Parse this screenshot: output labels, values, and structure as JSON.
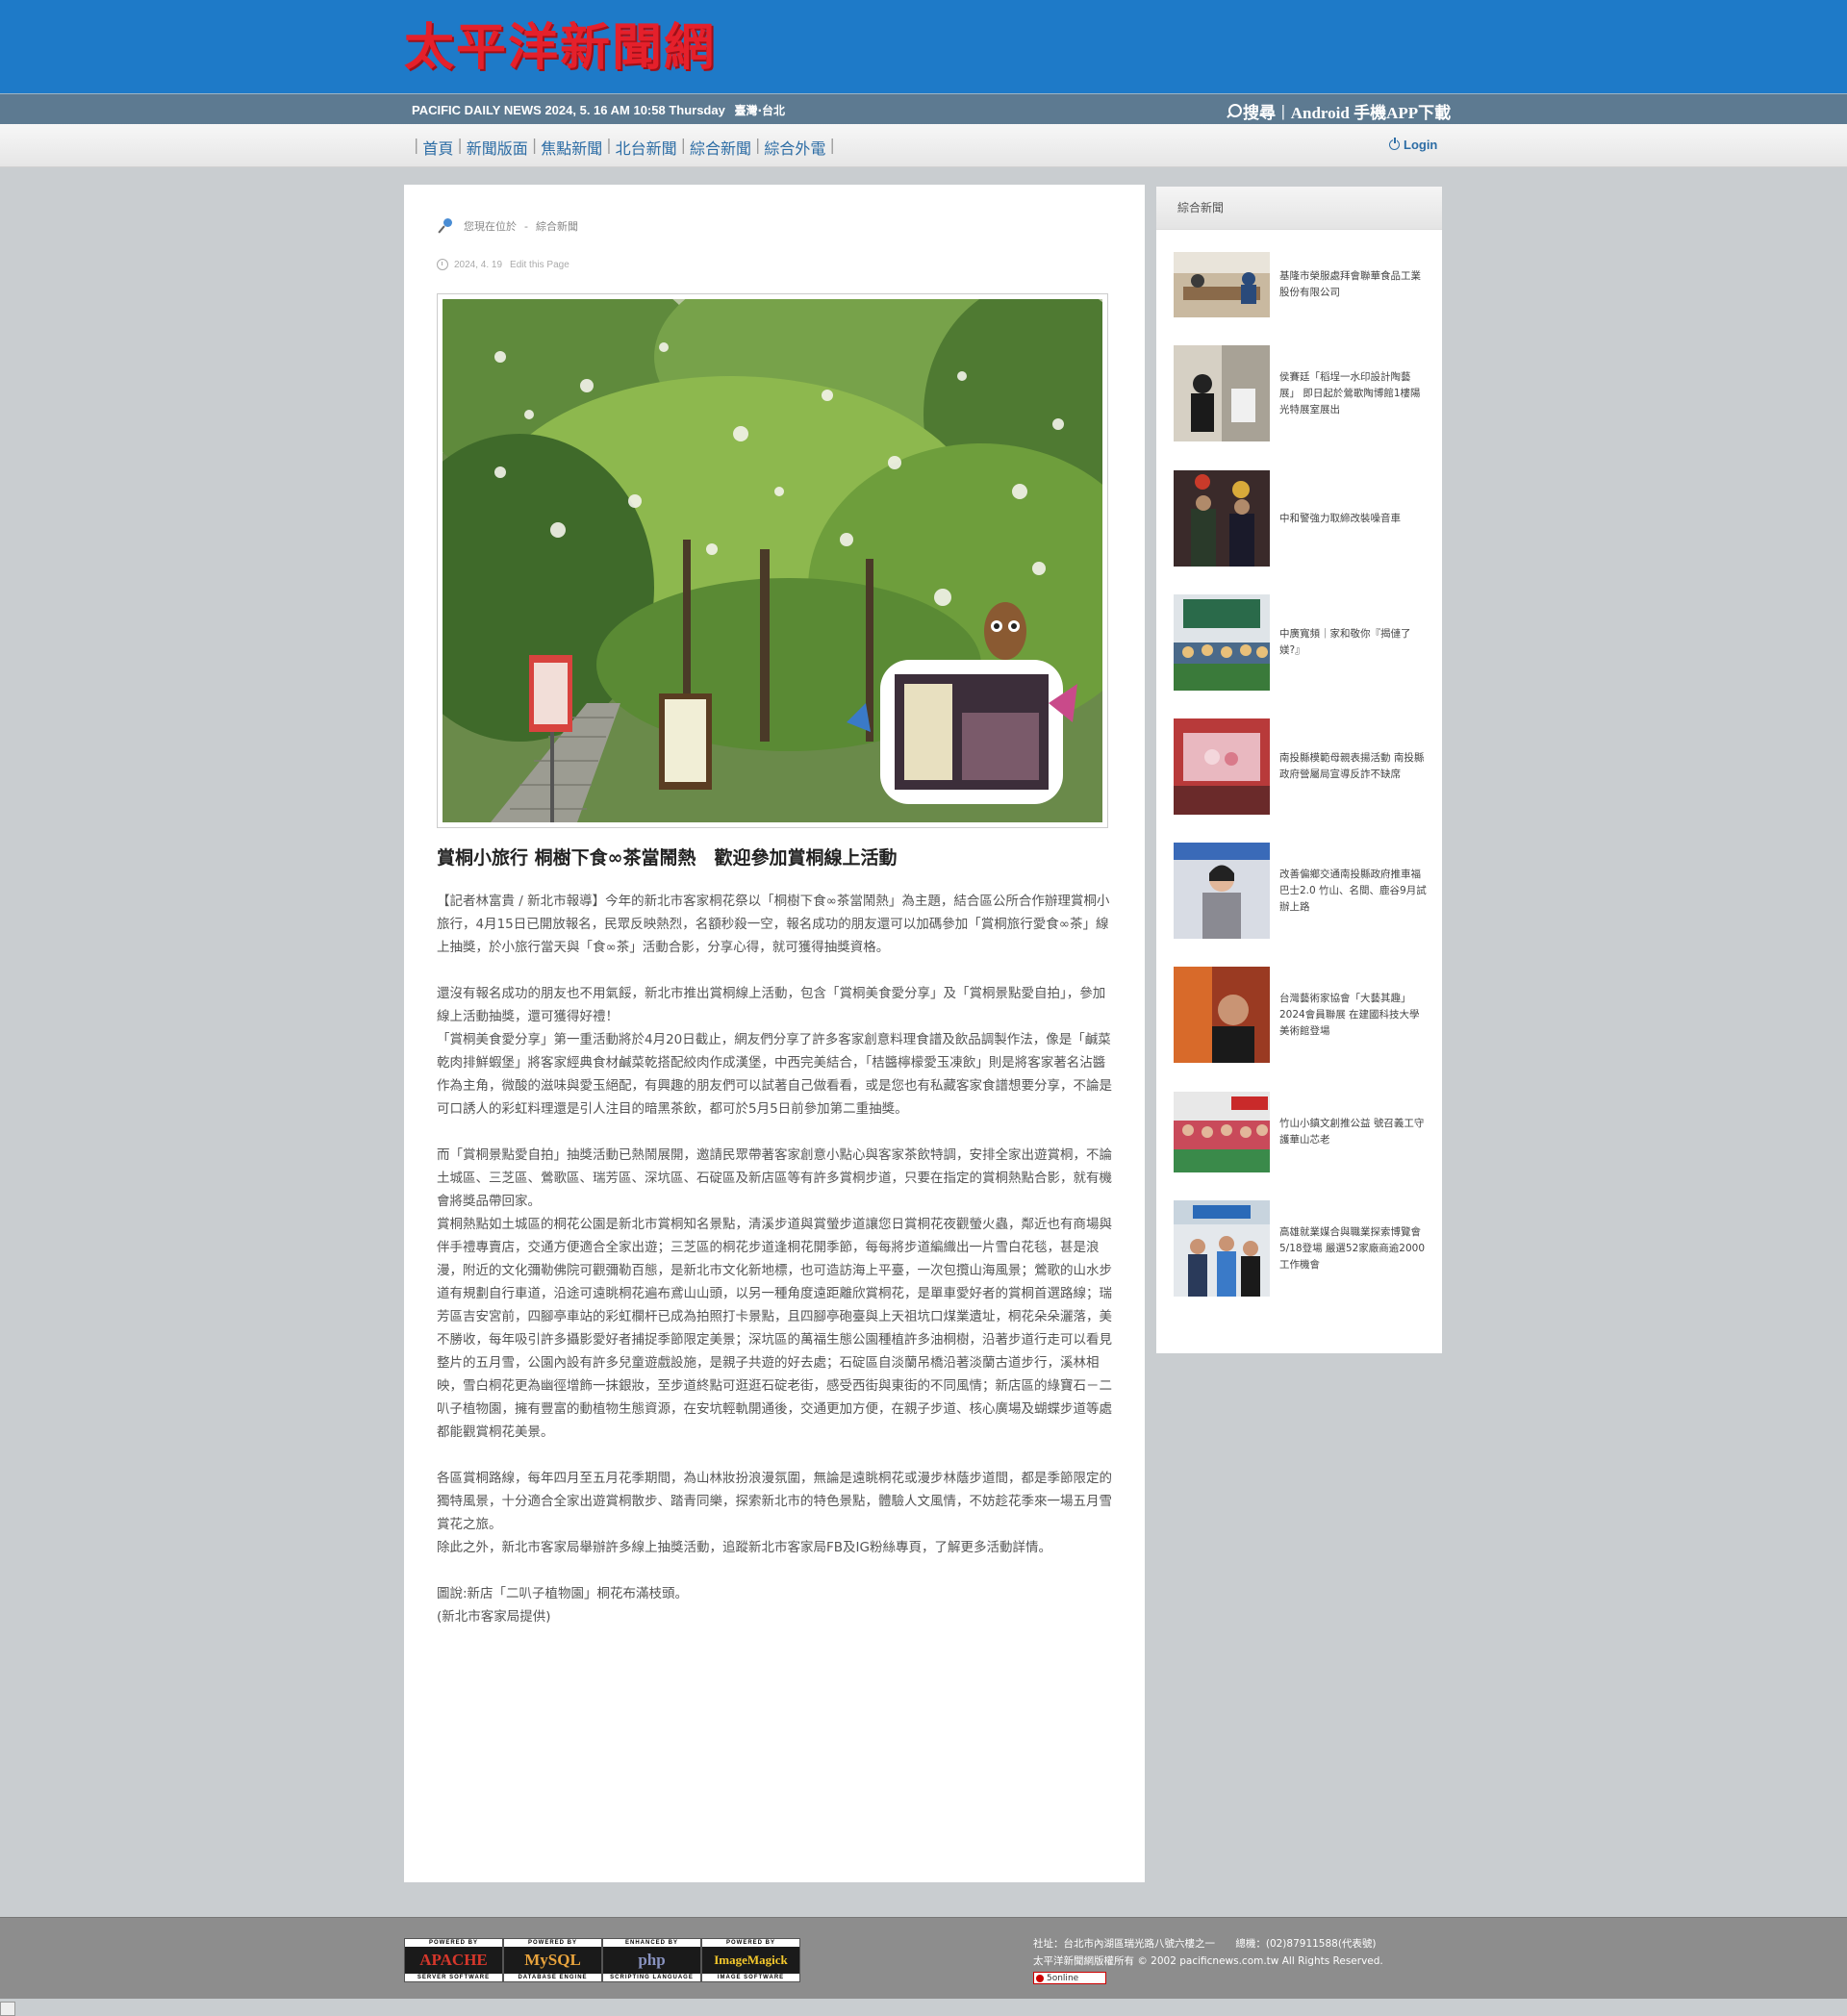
{
  "header": {
    "logo_text": "太平洋新聞網",
    "date_text": "PACIFIC DAILY NEWS 2024, 5. 16 AM 10:58 Thursday",
    "location": "臺灣·台北",
    "search_label": "搜尋",
    "app_label": "Android 手機APP下載"
  },
  "nav": {
    "items": [
      "首頁",
      "新聞版面",
      "焦點新聞",
      "北台新聞",
      "綜合新聞",
      "綜合外電"
    ],
    "login_label": "Login"
  },
  "article": {
    "breadcrumb_prefix": "您現在位於",
    "breadcrumb_section": "綜合新聞",
    "date": "2024, 4. 19",
    "edit_label": "Edit this Page",
    "title": "賞桐小旅行 桐樹下食∞茶當鬧熱　歡迎參加賞桐線上活動",
    "paragraphs": [
      "【記者林富貴 / 新北市報導】今年的新北市客家桐花祭以「桐樹下食∞茶當鬧熱」為主題，結合區公所合作辦理賞桐小旅行，4月15日已開放報名，民眾反映熱烈，名額秒殺一空，報名成功的朋友還可以加碼參加「賞桐旅行愛食∞茶」線上抽獎，於小旅行當天與「食∞茶」活動合影，分享心得，就可獲得抽獎資格。",
      "",
      "還沒有報名成功的朋友也不用氣餒，新北市推出賞桐線上活動，包含「賞桐美食愛分享」及「賞桐景點愛自拍」，參加線上活動抽獎，還可獲得好禮！",
      "「賞桐美食愛分享」第一重活動將於4月20日截止，網友們分享了許多客家創意料理食譜及飲品調製作法，像是「鹹菜乾肉排鮮蝦堡」將客家經典食材鹹菜乾搭配絞肉作成漢堡，中西完美結合，「桔醬檸檬愛玉凍飲」則是將客家著名沾醬作為主角，微酸的滋味與愛玉絕配，有興趣的朋友們可以試著自己做看看，或是您也有私藏客家食譜想要分享，不論是可口誘人的彩虹料理還是引人注目的暗黑茶飲，都可於5月5日前參加第二重抽獎。",
      "",
      "而「賞桐景點愛自拍」抽獎活動已熱鬧展開，邀請民眾帶著客家創意小點心與客家茶飲特調，安排全家出遊賞桐，不論土城區、三芝區、鶯歌區、瑞芳區、深坑區、石碇區及新店區等有許多賞桐步道，只要在指定的賞桐熱點合影，就有機會將獎品帶回家。",
      "賞桐熱點如土城區的桐花公園是新北市賞桐知名景點，清溪步道與賞螢步道讓您日賞桐花夜觀螢火蟲，鄰近也有商場與伴手禮專賣店，交通方便適合全家出遊；三芝區的桐花步道逢桐花開季節，每每將步道編織出一片雪白花毯，甚是浪漫，附近的文化彌勒佛院可觀彌勒百態，是新北市文化新地標，也可造訪海上平臺，一次包攬山海風景；鶯歌的山水步道有規劃自行車道，沿途可遠眺桐花遍布鳶山山頭，以另一種角度遠距離欣賞桐花，是單車愛好者的賞桐首選路線；瑞芳區吉安宮前，四腳亭車站的彩虹欄杆已成為拍照打卡景點，且四腳亭砲臺與上天祖坑口煤業遺址，桐花朵朵灑落，美不勝收，每年吸引許多攝影愛好者捕捉季節限定美景；深坑區的萬福生態公園種植許多油桐樹，沿著步道行走可以看見整片的五月雪，公園內設有許多兒童遊戲設施，是親子共遊的好去處；石碇區自淡蘭吊橋沿著淡蘭古道步行，溪林相映，雪白桐花更為幽徑增飾一抹銀妝，至步道終點可逛逛石碇老街，感受西街與東街的不同風情；新店區的綠寶石－二叭子植物園，擁有豐富的動植物生態資源，在安坑輕軌開通後，交通更加方便，在親子步道、核心廣場及蝴蝶步道等處都能觀賞桐花美景。",
      "",
      "各區賞桐路線，每年四月至五月花季期間，為山林妝扮浪漫氛圍，無論是遠眺桐花或漫步林蔭步道間，都是季節限定的獨特風景，十分適合全家出遊賞桐散步、踏青同樂，探索新北市的特色景點，體驗人文風情，不妨趁花季來一場五月雪賞花之旅。",
      "除此之外，新北市客家局舉辦許多線上抽獎活動，追蹤新北市客家局FB及IG粉絲專頁，了解更多活動詳情。",
      "",
      "圖說:新店「二叭子植物園」桐花布滿枝頭。",
      "(新北市客家局提供)"
    ]
  },
  "sidebar": {
    "heading": "綜合新聞",
    "items": [
      {
        "text": "基隆市榮服處拜會聯華食品工業股份有限公司"
      },
      {
        "text": "侯賽廷「稻埕一水印設計陶藝展」 即日起於鶯歌陶博館1樓陽光特展室展出"
      },
      {
        "text": "中和警強力取締改裝噪音車"
      },
      {
        "text": "中廣寬頻｜家和敬你『揭僆了媄?』"
      },
      {
        "text": "南投縣模範母親表揚活動 南投縣政府營屬局宣導反詐不缺席"
      },
      {
        "text": "改善偏鄉交通南投縣政府推車福巴士2.0 竹山、名間、鹿谷9月試辦上路"
      },
      {
        "text": "台灣藝術家協會「大藝其趣」2024會員聯展 在建國科技大學美術館登場"
      },
      {
        "text": "竹山小鎮文創推公益 號召義工守護華山芯老"
      },
      {
        "text": "高雄就業媒合與職業探索博覽會5/18登場 嚴選52家廠商逾2000工作機會"
      }
    ]
  },
  "footer": {
    "badges": [
      {
        "top": "POWERED BY",
        "mid": "APACHE",
        "bottom": "SERVER SOFTWARE",
        "color": "#d7372b"
      },
      {
        "top": "POWERED BY",
        "mid": "MySQL",
        "bottom": "DATABASE ENGINE",
        "color": "#e8a33c"
      },
      {
        "top": "ENHANCED BY",
        "mid": "php",
        "bottom": "SCRIPTING LANGUAGE",
        "color": "#8892bf"
      },
      {
        "top": "POWERED BY",
        "mid": "ImageMagick",
        "bottom": "IMAGE SOFTWARE",
        "color": "#f4c82c"
      }
    ],
    "address": "社址：台北市內湖區瑞光路八號六樓之一",
    "phone": "總機：(02)87911588(代表號)",
    "copyright": "太平洋新聞網版權所有 © 2002 pacificnews.com.tw All Rights Reserved.",
    "counter": "5online"
  },
  "colors": {
    "topbar": "#1e7ac8",
    "logo": "#e5202b",
    "datebar": "#5d7a91",
    "link": "#2d6da5"
  }
}
